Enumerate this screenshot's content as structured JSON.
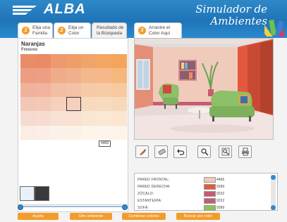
{
  "header": {
    "logo": "ALBA",
    "title_line1": "Simulador de",
    "title_line2": "Ambientes"
  },
  "tabs": [
    {
      "num": "1",
      "line1": "Elija una",
      "line2": "Familia"
    },
    {
      "num": "2",
      "line1": "Elija un",
      "line2": "Color"
    },
    {
      "num": "",
      "line1": "Resultado de",
      "line2": "la Búsqueda"
    },
    {
      "num": "3",
      "line1": "Arrastre el",
      "line2": "Color Aquí"
    }
  ],
  "palette": {
    "family": "Naranjas",
    "subfamily": "Frescos",
    "selected_code": "4466",
    "rows": [
      [
        "#e98d69",
        "#eb8a66",
        "#ee9a70",
        "#ef9e66",
        "#f1a46a",
        "#f4a664",
        "#f3a65b"
      ],
      [
        "#ec9d82",
        "#ee9e82",
        "#efac88",
        "#f0b08b",
        "#f3b88b",
        "#f4b88a",
        "#f5b77c"
      ],
      [
        "#efb29d",
        "#f1b39e",
        "#f2bfa5",
        "#f3c2a5",
        "#f5caa6",
        "#f6cca4",
        "#f6c99f"
      ],
      [
        "#f3c7b6",
        "#f3c8b7",
        "#f5d1bd",
        "#f6d0bd",
        "#f7d9be",
        "#f8dabd",
        "#f8d8ba"
      ],
      [
        "#f5dbcf",
        "#f6dccf",
        "#f7e1d3",
        "#f8e1d2",
        "#f9e6d3",
        "#f9e8d4",
        "#faE6d1"
      ],
      [
        "#fbede4",
        "#fbeee6",
        "#fcf1e8",
        "#fcf1e7",
        "#fdf4ea",
        "#fdf5eb",
        "#fdf3e8"
      ]
    ],
    "selected_row": 3,
    "selected_col": 3,
    "selection_swatches": [
      "#e8f1fa",
      "#3a3a3a"
    ]
  },
  "tools": [
    "brush-icon",
    "eraser-icon",
    "undo-icon",
    "magnify-icon",
    "zoom-icon",
    "print-icon"
  ],
  "legend": [
    {
      "label": "PARED FRONTAL:",
      "color": "#f3c8b6",
      "code": "4466"
    },
    {
      "label": "PARED DERECHA:",
      "color": "#e3593d",
      "code": "9289"
    },
    {
      "label": "ZÓCALO:",
      "color": "#c85a72",
      "code": "9232"
    },
    {
      "label": "ESTANTERÍA:",
      "color": "#c85a72",
      "code": "9232"
    },
    {
      "label": "SOFÁ:",
      "color": "#8fc05a",
      "code": "9289"
    }
  ],
  "buttons": {
    "help": "Ayuda",
    "other_room": "Otro ambiente",
    "combine": "Combinar colores",
    "search": "Buscar por color"
  },
  "colors": {
    "accent": "#f39c2b",
    "brand_blue": "#2e88c8"
  }
}
